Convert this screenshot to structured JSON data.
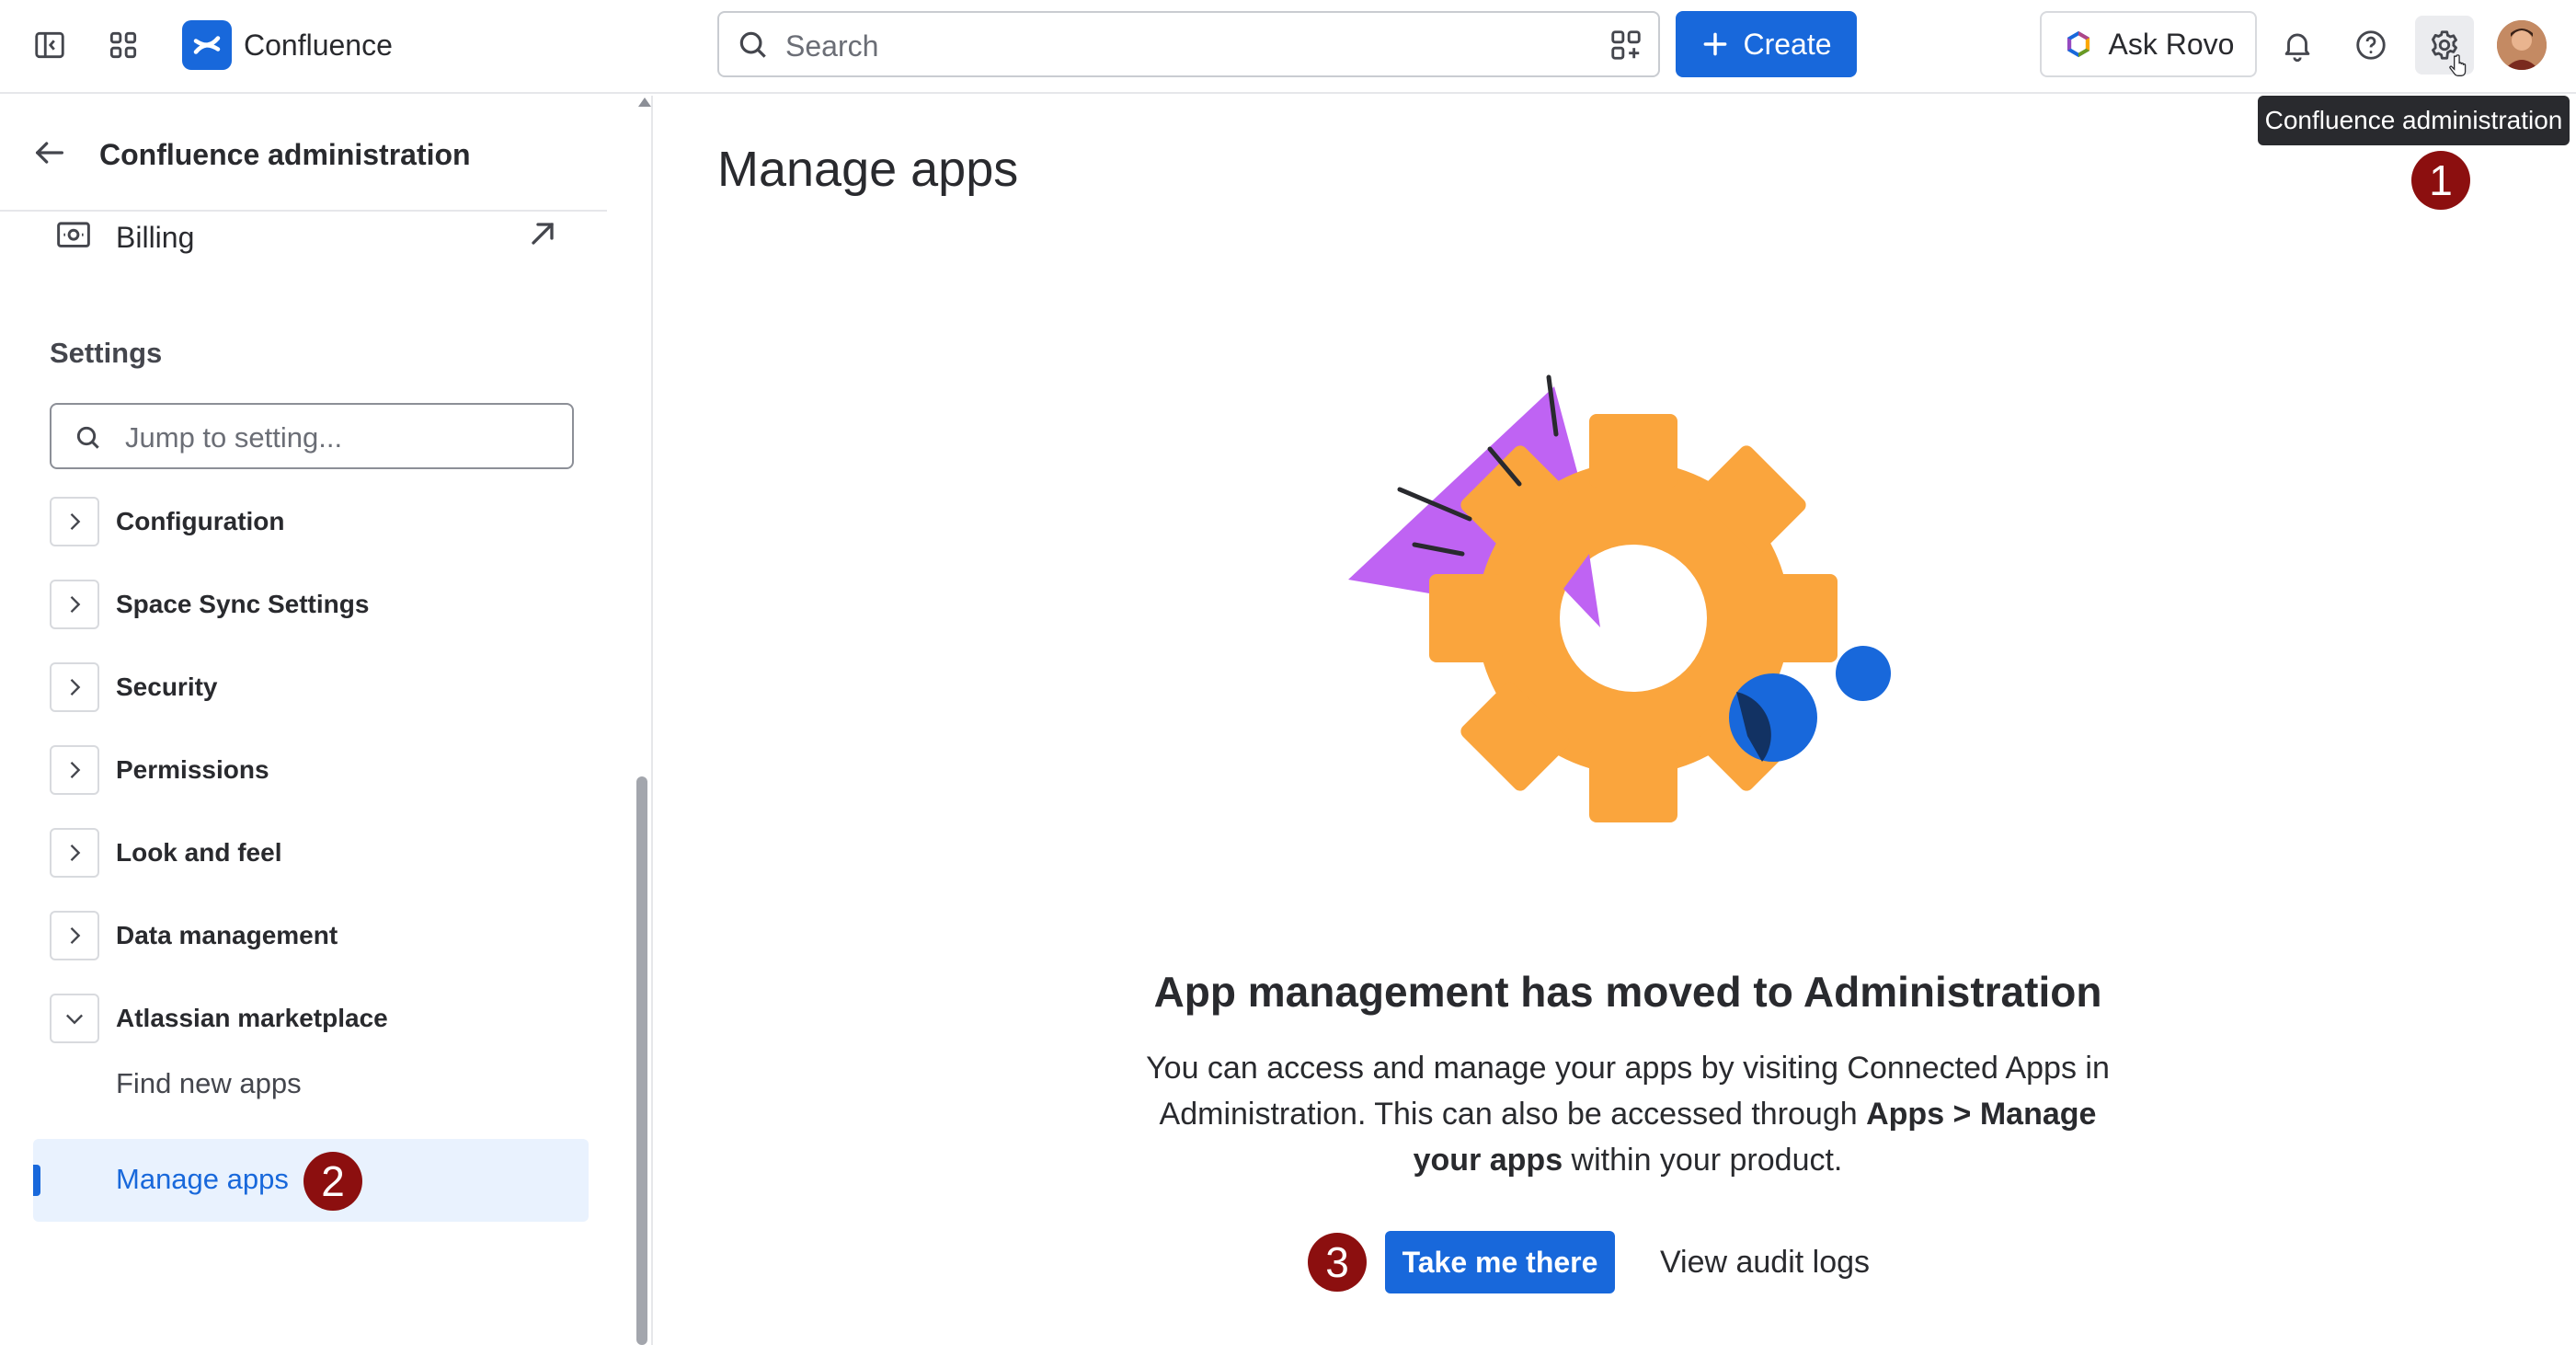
{
  "app": {
    "name": "Confluence",
    "brand_color": "#1868db"
  },
  "topbar": {
    "search_placeholder": "Search",
    "create_label": "Create",
    "ask_rovo_label": "Ask Rovo",
    "tooltip": "Confluence administration",
    "icons": [
      "sidebar-toggle-icon",
      "app-switcher-icon",
      "confluence-logo-icon",
      "search-icon",
      "apps-add-icon",
      "plus-icon",
      "rovo-icon",
      "bell-icon",
      "help-icon",
      "gear-icon",
      "avatar"
    ]
  },
  "sidebar": {
    "title": "Confluence administration",
    "billing_label": "Billing",
    "settings_heading": "Settings",
    "jump_placeholder": "Jump to setting...",
    "items": [
      {
        "label": "Configuration",
        "expanded": false
      },
      {
        "label": "Space Sync Settings",
        "expanded": false
      },
      {
        "label": "Security",
        "expanded": false
      },
      {
        "label": "Permissions",
        "expanded": false
      },
      {
        "label": "Look and feel",
        "expanded": false
      },
      {
        "label": "Data management",
        "expanded": false
      },
      {
        "label": "Atlassian marketplace",
        "expanded": true
      }
    ],
    "subitems": [
      {
        "label": "Find new apps",
        "active": false
      },
      {
        "label": "Manage apps",
        "active": true
      }
    ]
  },
  "main": {
    "title": "Manage apps",
    "heading": "App management has moved to Administration",
    "description_pre": "You can access and manage your apps by visiting Connected Apps in Administration. This can also be accessed through ",
    "description_bold": "Apps > Manage your apps",
    "description_post": " within your product.",
    "primary_button": "Take me there",
    "secondary_button": "View audit logs"
  },
  "annotations": {
    "step1": "1",
    "step2": "2",
    "step3": "3",
    "color": "#8c0f0f"
  }
}
